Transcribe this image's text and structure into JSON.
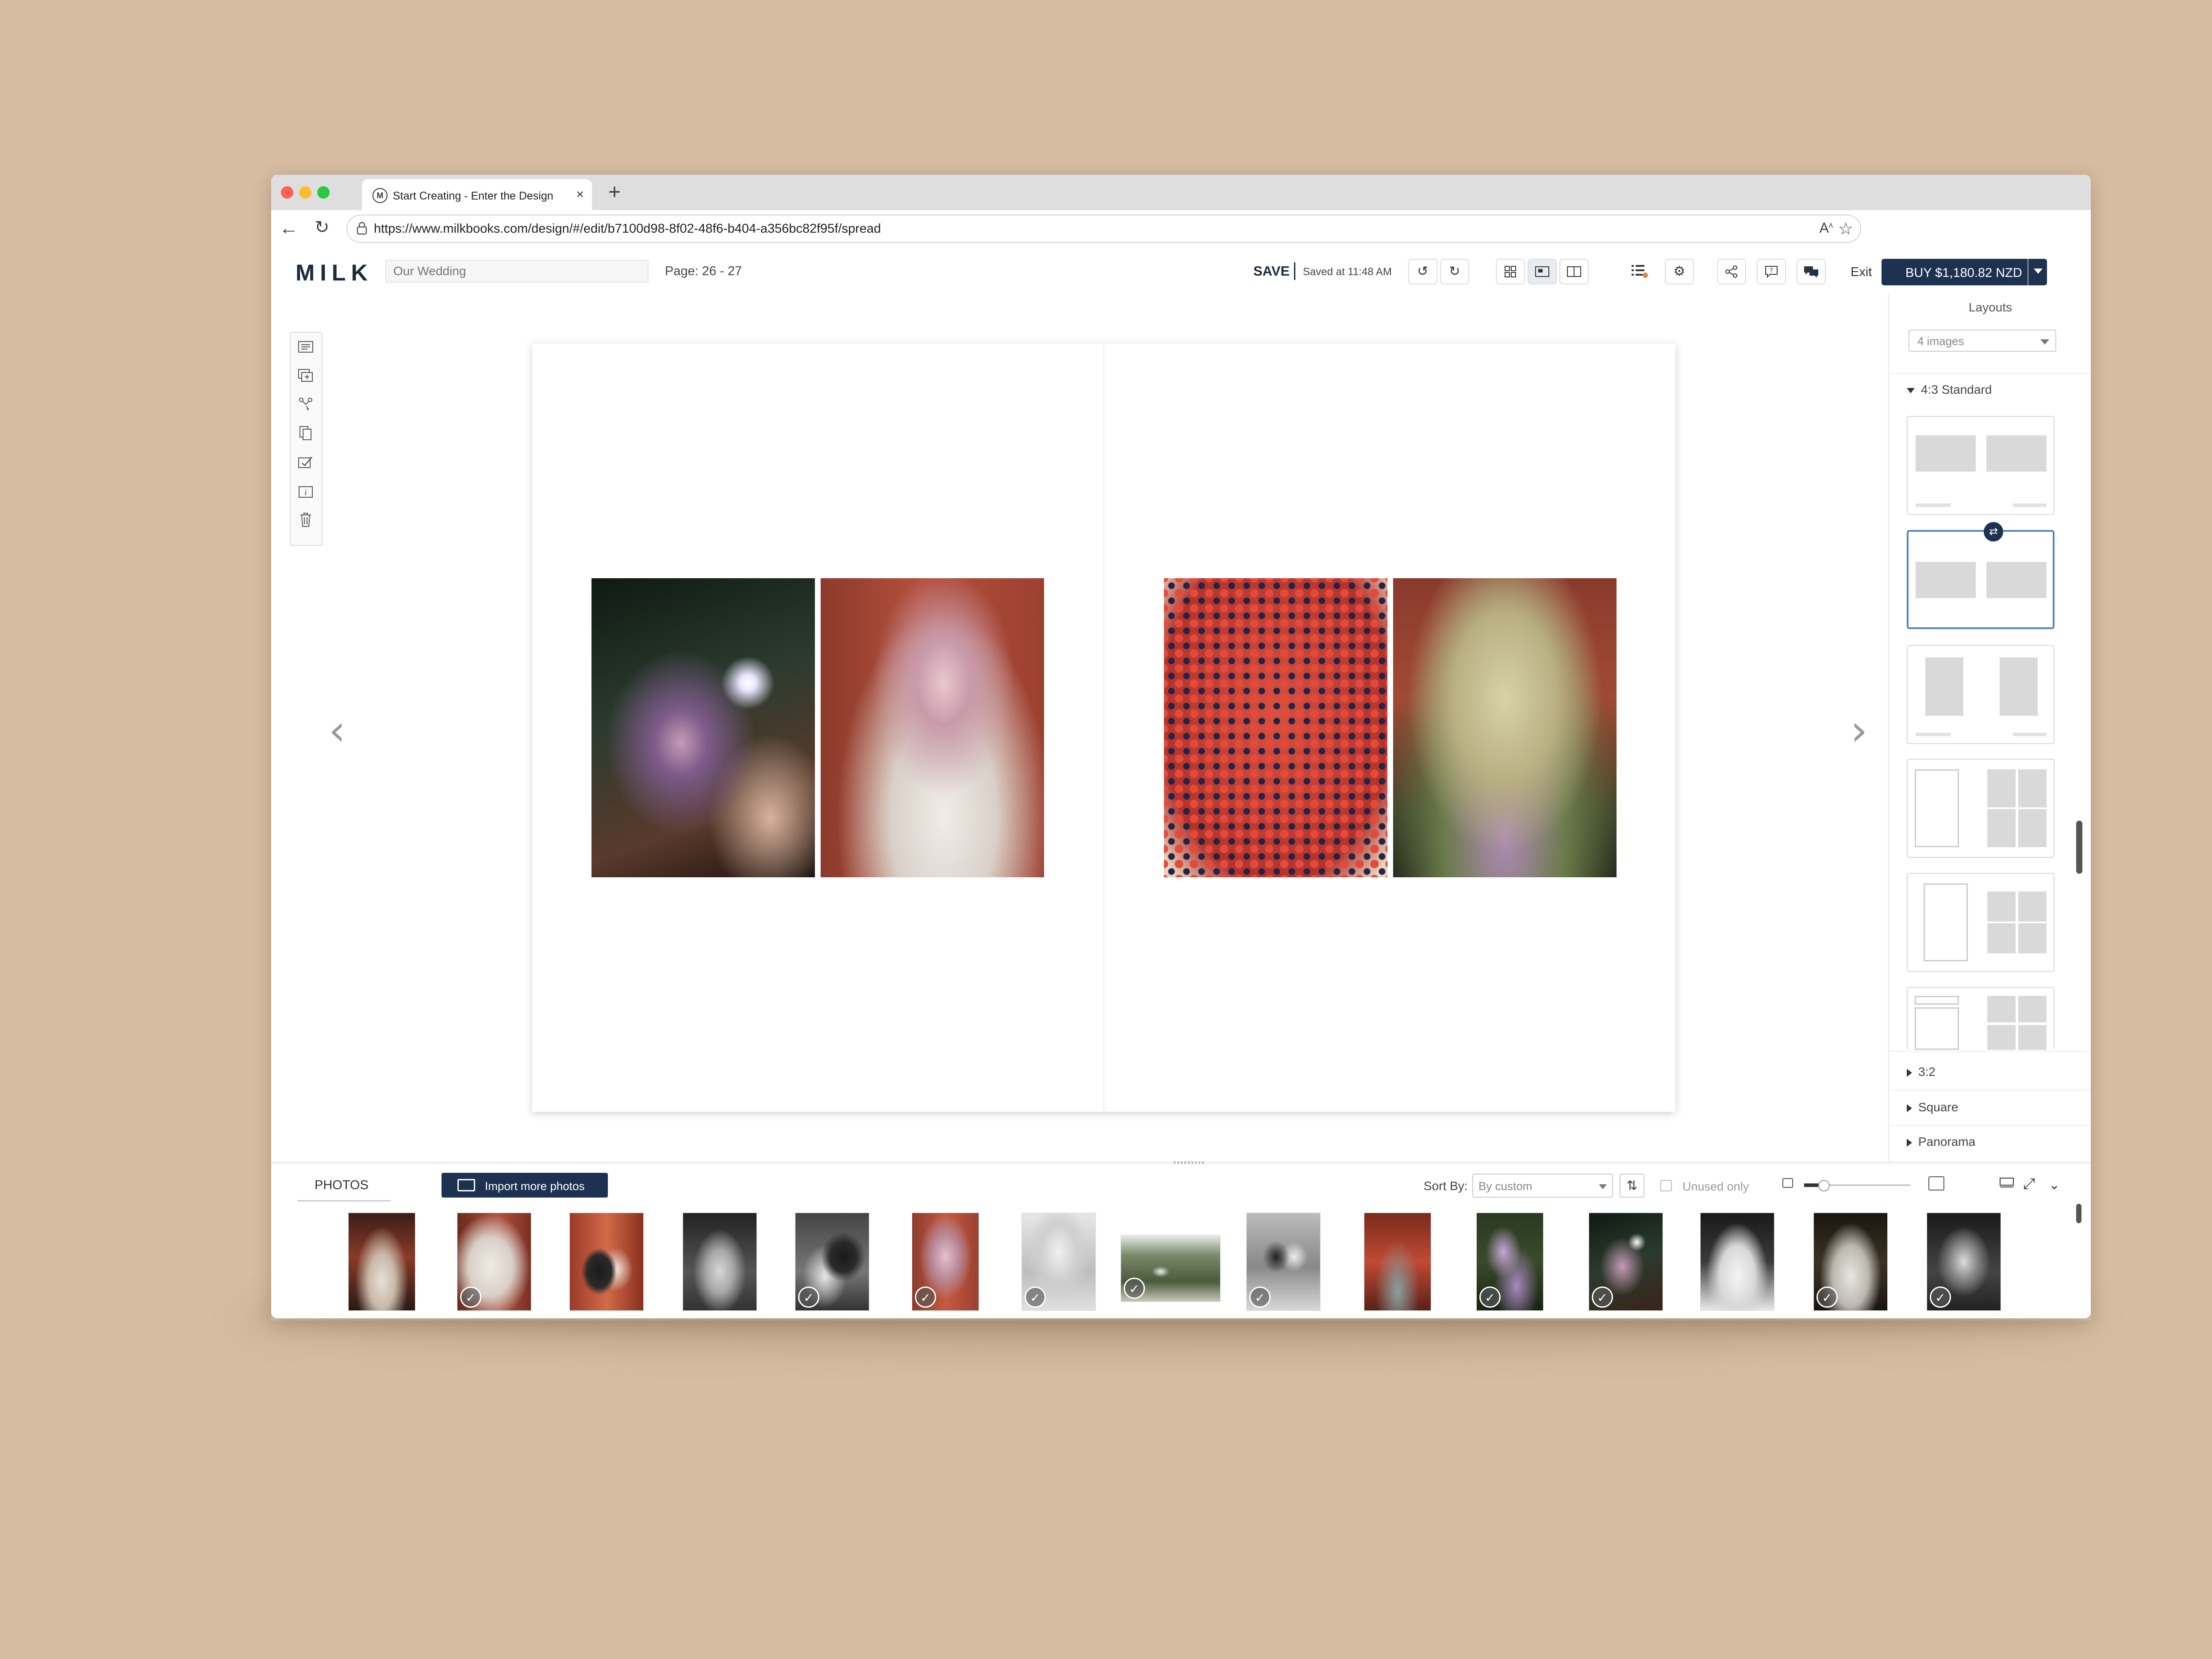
{
  "browser": {
    "tab_title": "Start Creating - Enter the Design",
    "favicon_letter": "M",
    "url": "https://www.milkbooks.com/design/#/edit/b7100d98-8f02-48f6-b404-a356bc82f95f/spread"
  },
  "app": {
    "logo": "MILK",
    "book_name_placeholder": "Our Wedding",
    "page_info": "Page: 26 - 27",
    "save_label": "SAVE",
    "saved_status": "Saved at 11:48 AM",
    "exit_label": "Exit",
    "buy_label": "BUY $1,180.82 NZD"
  },
  "layouts_panel": {
    "title": "Layouts",
    "filter_value": "4 images",
    "groups": [
      {
        "label": "4:3 Standard",
        "expanded": true
      },
      {
        "label": "3:2",
        "expanded": false
      },
      {
        "label": "Square",
        "expanded": false
      },
      {
        "label": "Panorama",
        "expanded": false
      }
    ],
    "selected_layout_index": 1
  },
  "photos_strip": {
    "tab_label": "PHOTOS",
    "import_label": "Import more photos",
    "sort_by_label": "Sort By:",
    "sort_value": "By custom",
    "unused_only_label": "Unused only",
    "thumbnails": [
      {
        "scene": "venue-warm",
        "used": false
      },
      {
        "scene": "bride-veil-warm",
        "used": true
      },
      {
        "scene": "couple-red",
        "used": false
      },
      {
        "scene": "couple-bw",
        "used": false
      },
      {
        "scene": "groom-seated-bw",
        "used": true
      },
      {
        "scene": "bouquet-red",
        "used": true
      },
      {
        "scene": "floral-bw",
        "used": true
      },
      {
        "scene": "landscape-garden",
        "used": true
      },
      {
        "scene": "couple-cake-bw",
        "used": true
      },
      {
        "scene": "table-red",
        "used": false
      },
      {
        "scene": "flowers-purple",
        "used": true
      },
      {
        "scene": "bouquet-night",
        "used": true
      },
      {
        "scene": "gown-back-bw",
        "used": false
      },
      {
        "scene": "gown-veil-dark",
        "used": true
      },
      {
        "scene": "couple-dance-bw",
        "used": true
      }
    ]
  },
  "colors": {
    "brand_navy": "#1c3250",
    "selected_layout_border": "#4d86c5",
    "backdrop": "#d6bda2"
  },
  "icons": {
    "window_controls": [
      "close-dot",
      "minimize-dot",
      "maximize-dot"
    ],
    "left_tools": [
      "text-box-icon",
      "add-page-icon",
      "auto-fill-icon",
      "copy-page-icon",
      "style-icon",
      "info-icon",
      "trash-icon"
    ],
    "toolbar": [
      "undo-icon",
      "redo-icon",
      "grid-view-icon",
      "single-page-view-icon",
      "spread-view-icon",
      "checklist-icon",
      "settings-icon",
      "share-icon",
      "comment-icon",
      "chat-icon"
    ]
  }
}
